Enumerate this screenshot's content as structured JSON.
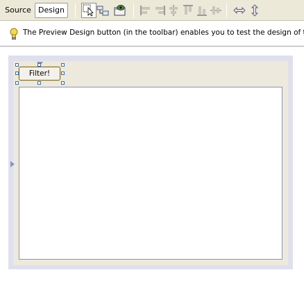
{
  "toolbar": {
    "tabs": [
      {
        "label": "Source",
        "selected": false
      },
      {
        "label": "Design",
        "selected": true
      }
    ],
    "icons": [
      "selection-mode-icon",
      "connection-mode-icon",
      "preview-design-icon",
      "align-left-icon",
      "align-right-icon",
      "center-horizontally-icon",
      "align-top-icon",
      "align-bottom-icon",
      "center-vertically-icon",
      "same-width-icon",
      "same-height-icon"
    ]
  },
  "info": {
    "message": "The Preview Design button (in the toolbar) enables you to test the design of the form"
  },
  "form": {
    "button_label": "Filter!"
  },
  "colors": {
    "toolbar_bg": "#ece9d8",
    "canvas_border": "#dfe0ee",
    "form_bg": "#ede9dc",
    "selection_handle": "#3a6ea5"
  }
}
